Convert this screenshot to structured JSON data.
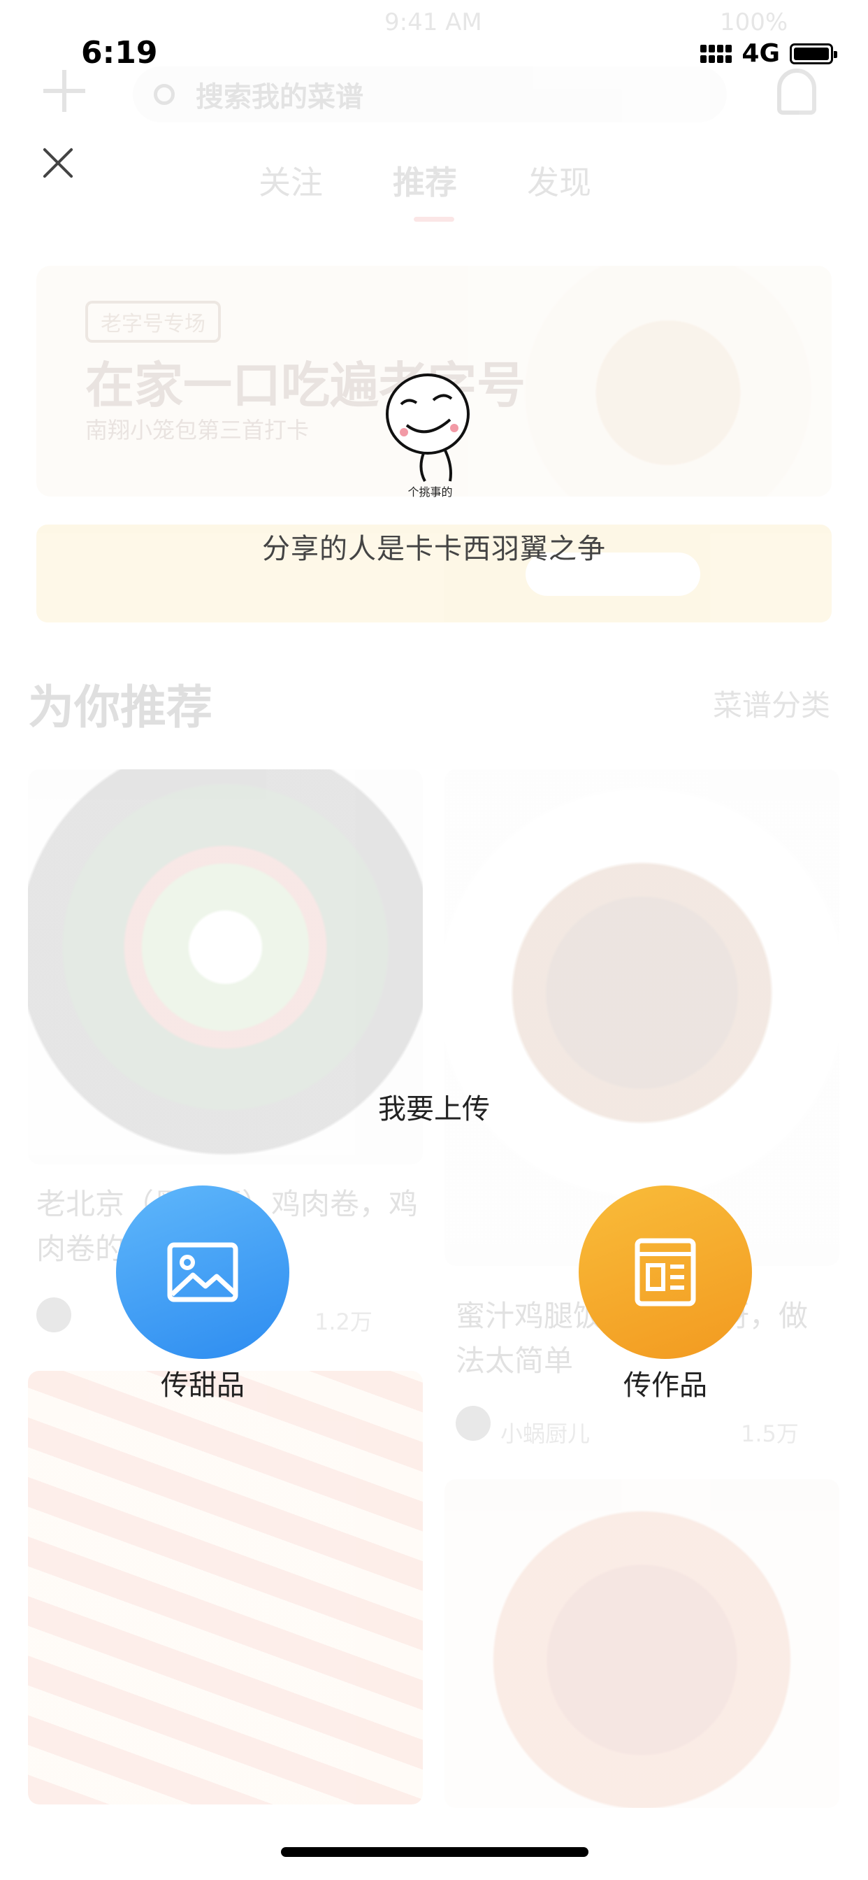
{
  "status_bar": {
    "time": "6:19",
    "network": "4G",
    "faded_time": "9:41 AM",
    "faded_battery": "100%"
  },
  "background_app": {
    "search_placeholder": "搜索我的菜谱",
    "tabs": [
      "关注",
      "推荐",
      "发现"
    ],
    "banner": {
      "tag": "老字号专场",
      "title": "在家一口吃遍老字号",
      "subtitle": "南翔小笼包第三首打卡"
    },
    "section_title": "为你推荐",
    "section_more": "菜谱分类",
    "cards": [
      {
        "title": "老北京（墨西哥）鸡肉卷，鸡肉卷的...平时做...",
        "likes": "1.2万"
      },
      {
        "title": "蜜汁鸡腿饭我的最爱呀，做法太简单",
        "author": "小蜗厨儿",
        "likes": "1.5万"
      }
    ]
  },
  "overlay": {
    "sticker_caption": "个挑事的",
    "share_text": "分享的人是卡卡西羽翼之争",
    "upload_title": "我要上传",
    "buttons": [
      {
        "label": "传甜品",
        "icon": "image-icon",
        "color": "#3a9cf5"
      },
      {
        "label": "传作品",
        "icon": "document-icon",
        "color": "#f5a623"
      }
    ]
  }
}
